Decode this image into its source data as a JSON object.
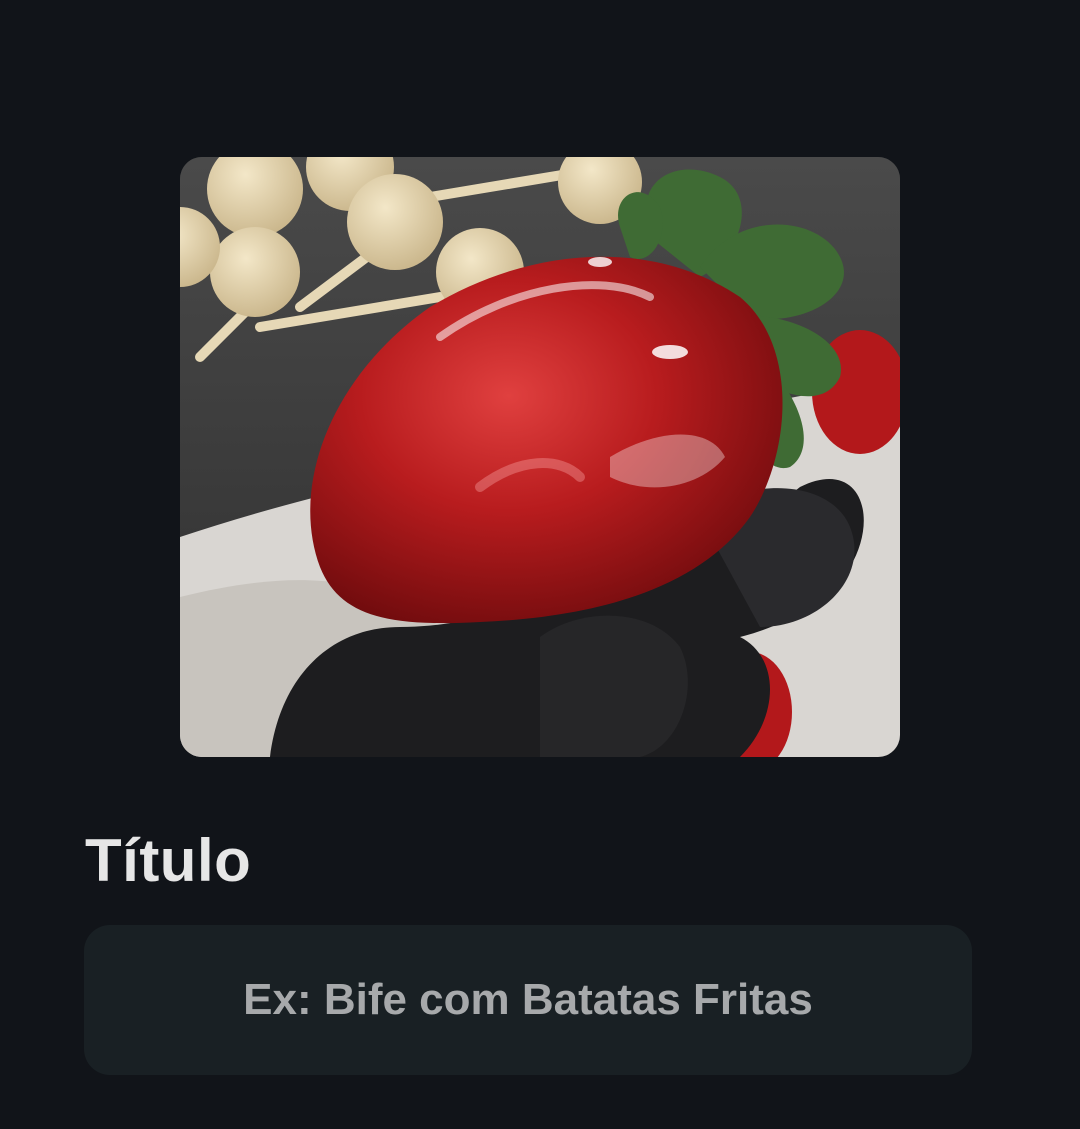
{
  "image": {
    "alt_icon": "photo-strawberry",
    "subject": "candied-strawberry"
  },
  "form": {
    "title_label": "Título",
    "title_placeholder": "Ex: Bife com Batatas Fritas",
    "title_value": ""
  },
  "colors": {
    "background": "#111419",
    "input_background": "#192024",
    "label_text": "#e6e6e6",
    "placeholder_text": "#a7a9ab"
  }
}
